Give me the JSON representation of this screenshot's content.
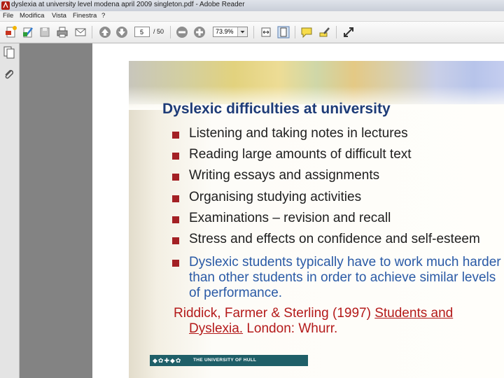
{
  "window": {
    "title": "dyslexia at university level modena april 2009 singleton.pdf - Adobe Reader"
  },
  "menu": [
    "File",
    "Modifica",
    "Vista",
    "Finestra",
    "?"
  ],
  "toolbar": {
    "current_page": "5",
    "total_pages": "/ 50",
    "zoom": "73.9%"
  },
  "slide": {
    "title": "Dyslexic difficulties at university",
    "bullets": [
      "Listening and taking notes in lectures",
      "Reading large amounts of difficult text",
      "Writing essays and assignments",
      "Organising studying activities",
      "Examinations – revision and recall",
      "Stress and effects on confidence and self-esteem"
    ],
    "emphasis_lines": [
      "Dyslexic students typically have to work much harder",
      "than other students in order to achieve similar levels",
      "of performance."
    ],
    "reference": {
      "authors": "Riddick, Farmer & Sterling (1997) ",
      "book": "Students and",
      "book_cont": "Dyslexia.",
      "publisher": " London: Whurr."
    },
    "footer_text": "THE UNIVERSITY OF HULL"
  },
  "colors": {
    "title": "#1d3b77",
    "bullet": "#a32024",
    "emphasis": "#2a5aa6",
    "reference": "#b41a1a",
    "footer": "#1f5f68"
  }
}
